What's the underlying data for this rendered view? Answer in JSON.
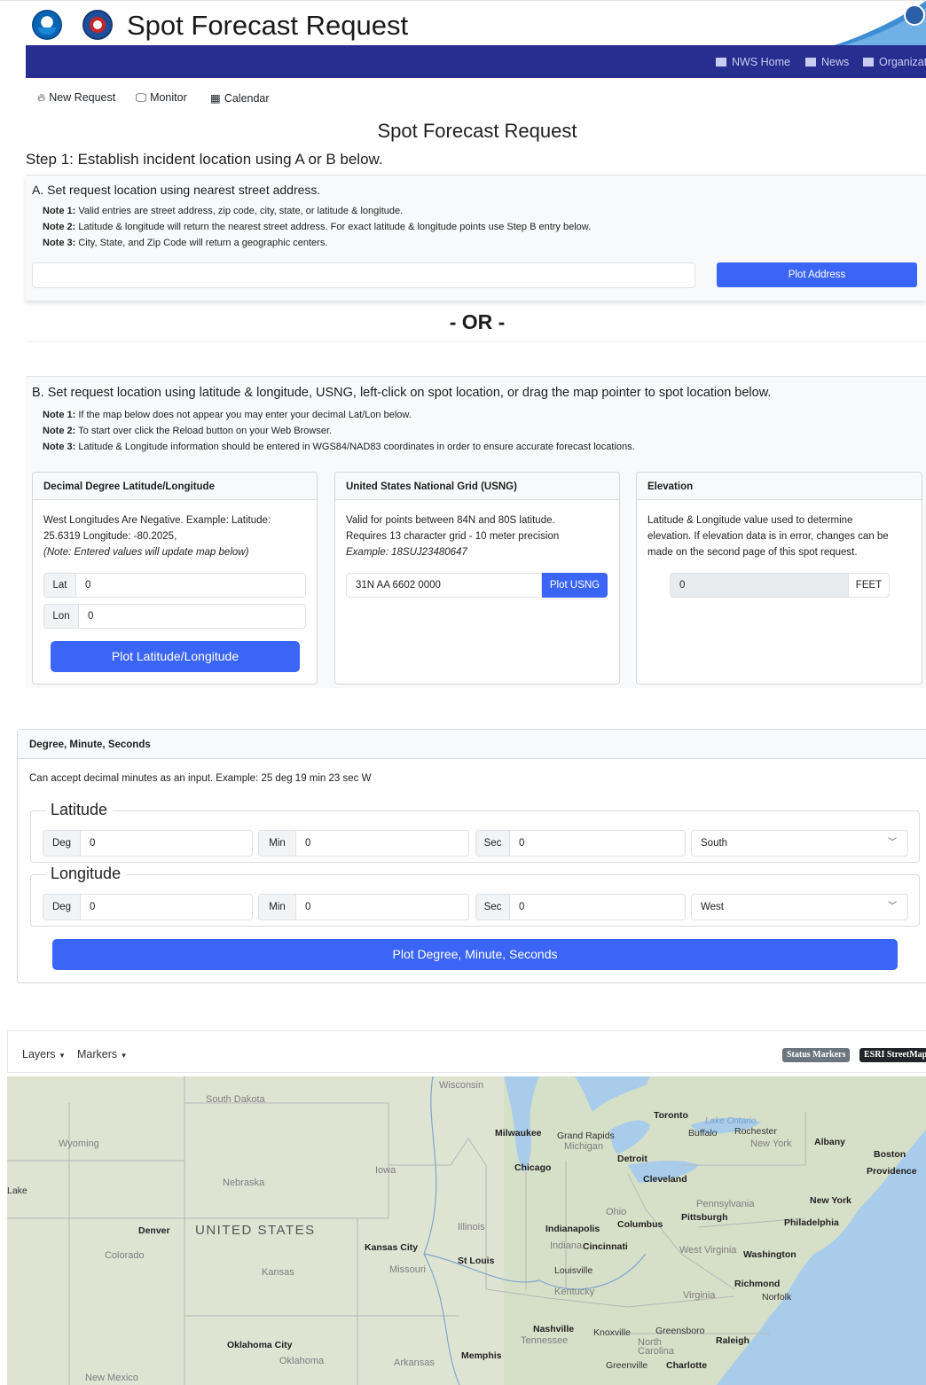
{
  "header": {
    "title": "Spot Forecast Request",
    "nav": {
      "home": "NWS Home",
      "news": "News",
      "org": "Organization"
    }
  },
  "subnav": {
    "new_request": "New Request",
    "monitor": "Monitor",
    "calendar": "Calendar"
  },
  "page": {
    "title": "Spot Forecast Request",
    "step1": "Step 1: Establish incident location using A or B below.",
    "or_label": "- OR -"
  },
  "panelA": {
    "title": "A. Set request location using nearest street address.",
    "notes": [
      {
        "label": "Note 1:",
        "text": " Valid entries are street address, zip code, city, state, or latitude & longitude."
      },
      {
        "label": "Note 2:",
        "text": " Latitude & longitude will return the nearest street address. For exact latitude & longitude points use Step B entry below."
      },
      {
        "label": "Note 3:",
        "text": " City, State, and Zip Code will return a geographic centers."
      }
    ],
    "address_value": "",
    "plot_button": "Plot Address"
  },
  "panelB": {
    "title": "B. Set request location using latitude & longitude, USNG, left-click on spot location, or drag the map pointer to spot location below.",
    "notes": [
      {
        "label": "Note 1:",
        "text": " If the map below does not appear you may enter your decimal Lat/Lon below."
      },
      {
        "label": "Note 2:",
        "text": " To start over click the Reload button on your Web Browser."
      },
      {
        "label": "Note 3:",
        "text": " Latitude & Longitude information should be entered in WGS84/NAD83 coordinates in order to ensure accurate forecast locations."
      }
    ],
    "decimal": {
      "header": "Decimal Degree Latitude/Longitude",
      "line1": "West Longitudes Are Negative. Example: Latitude:",
      "line2": "25.6319 Longitude: -80.2025,",
      "line3": "(Note: Entered values will update map below)",
      "lat_label": "Lat",
      "lat_value": "0",
      "lon_label": "Lon",
      "lon_value": "0",
      "button": "Plot Latitude/Longitude"
    },
    "usng": {
      "header": "United States National Grid (USNG)",
      "line1": "Valid for points between 84N and 80S latitude.",
      "line2": "Requires 13 character grid - 10 meter precision",
      "line3": "Example: 18SUJ23480647",
      "value": "31N AA 6602 0000",
      "button": "Plot USNG"
    },
    "elevation": {
      "header": "Elevation",
      "line1": "Latitude & Longitude value used to determine",
      "line2": "elevation. If elevation data is in error, changes can be",
      "line3": "made on the second page of this spot request.",
      "value": "0",
      "unit": "FEET"
    }
  },
  "dms": {
    "header": "Degree, Minute, Seconds",
    "text": "Can accept decimal minutes as an input. Example: 25 deg 19 min 23 sec W",
    "latitude": {
      "legend": "Latitude",
      "deg_label": "Deg",
      "deg": "0",
      "min_label": "Min",
      "min": "0",
      "sec_label": "Sec",
      "sec": "0",
      "hemisphere": "South"
    },
    "longitude": {
      "legend": "Longitude",
      "deg_label": "Deg",
      "deg": "0",
      "min_label": "Min",
      "min": "0",
      "sec_label": "Sec",
      "sec": "0",
      "hemisphere": "West"
    },
    "button": "Plot Degree, Minute, Seconds"
  },
  "map": {
    "layers": "Layers",
    "markers": "Markers",
    "badge_status": "Status Markers",
    "badge_basemap": "ESRI StreetMap",
    "labels": {
      "wisconsin": "Wisconsin",
      "south_dakota": "South Dakota",
      "wyoming": "Wyoming",
      "iowa": "Iowa",
      "nebraska": "Nebraska",
      "lake": "Lake",
      "united_states": "UNITED STATES",
      "denver": "Denver",
      "colorado": "Colorado",
      "kansas": "Kansas",
      "kansas_city": "Kansas City",
      "illinois": "Illinois",
      "missouri": "Missouri",
      "st_louis": "St Louis",
      "milwaukee": "Milwaukee",
      "grand_rapids": "Grand Rapids",
      "michigan": "Michigan",
      "chicago": "Chicago",
      "detroit": "Detroit",
      "toronto": "Toronto",
      "lake_ontario": "Lake Ontario",
      "buffalo": "Buffalo",
      "rochester": "Rochester",
      "new_york_state": "New York",
      "albany": "Albany",
      "boston": "Boston",
      "providence": "Providence",
      "cleveland": "Cleveland",
      "ohio": "Ohio",
      "pennsylvania": "Pennsylvania",
      "pittsburgh": "Pittsburgh",
      "new_york": "New York",
      "philadelphia": "Philadelphia",
      "indianapolis": "Indianapolis",
      "columbus": "Columbus",
      "indiana": "Indiana",
      "cincinnati": "Cincinnati",
      "west_virginia": "West Virginia",
      "washington": "Washington",
      "louisville": "Louisville",
      "kentucky": "Kentucky",
      "virginia": "Virginia",
      "richmond": "Richmond",
      "norfolk": "Norfolk",
      "nashville": "Nashville",
      "knoxville": "Knoxville",
      "greensboro": "Greensboro",
      "north_carolina": "North Carolina",
      "raleigh": "Raleigh",
      "tennessee": "Tennessee",
      "memphis": "Memphis",
      "greenville": "Greenville",
      "charlotte": "Charlotte",
      "oklahoma_city": "Oklahoma City",
      "oklahoma": "Oklahoma",
      "arkansas": "Arkansas",
      "new_mexico": "New Mexico"
    }
  }
}
